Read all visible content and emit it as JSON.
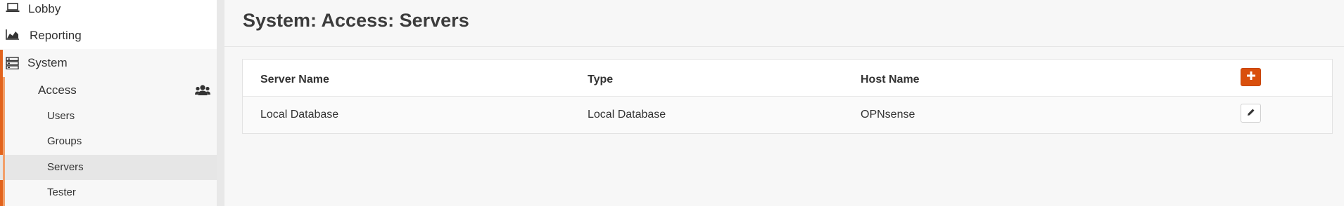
{
  "sidebar": {
    "items": [
      {
        "label": "Lobby",
        "icon": "laptop-icon"
      },
      {
        "label": "Reporting",
        "icon": "area-chart-icon"
      },
      {
        "label": "System",
        "icon": "server-icon"
      }
    ],
    "access": {
      "label": "Access",
      "icon": "users-icon"
    },
    "access_children": [
      "Users",
      "Groups",
      "Servers",
      "Tester"
    ],
    "active_child": "Servers"
  },
  "page": {
    "title": "System: Access: Servers"
  },
  "table": {
    "columns": [
      "Server Name",
      "Type",
      "Host Name"
    ],
    "rows": [
      {
        "server_name": "Local Database",
        "type": "Local Database",
        "host_name": "OPNsense"
      }
    ],
    "add_icon": "plus-icon",
    "edit_icon": "pencil-icon"
  },
  "colors": {
    "accent": "#e2631c",
    "add_button": "#d94f0c"
  }
}
